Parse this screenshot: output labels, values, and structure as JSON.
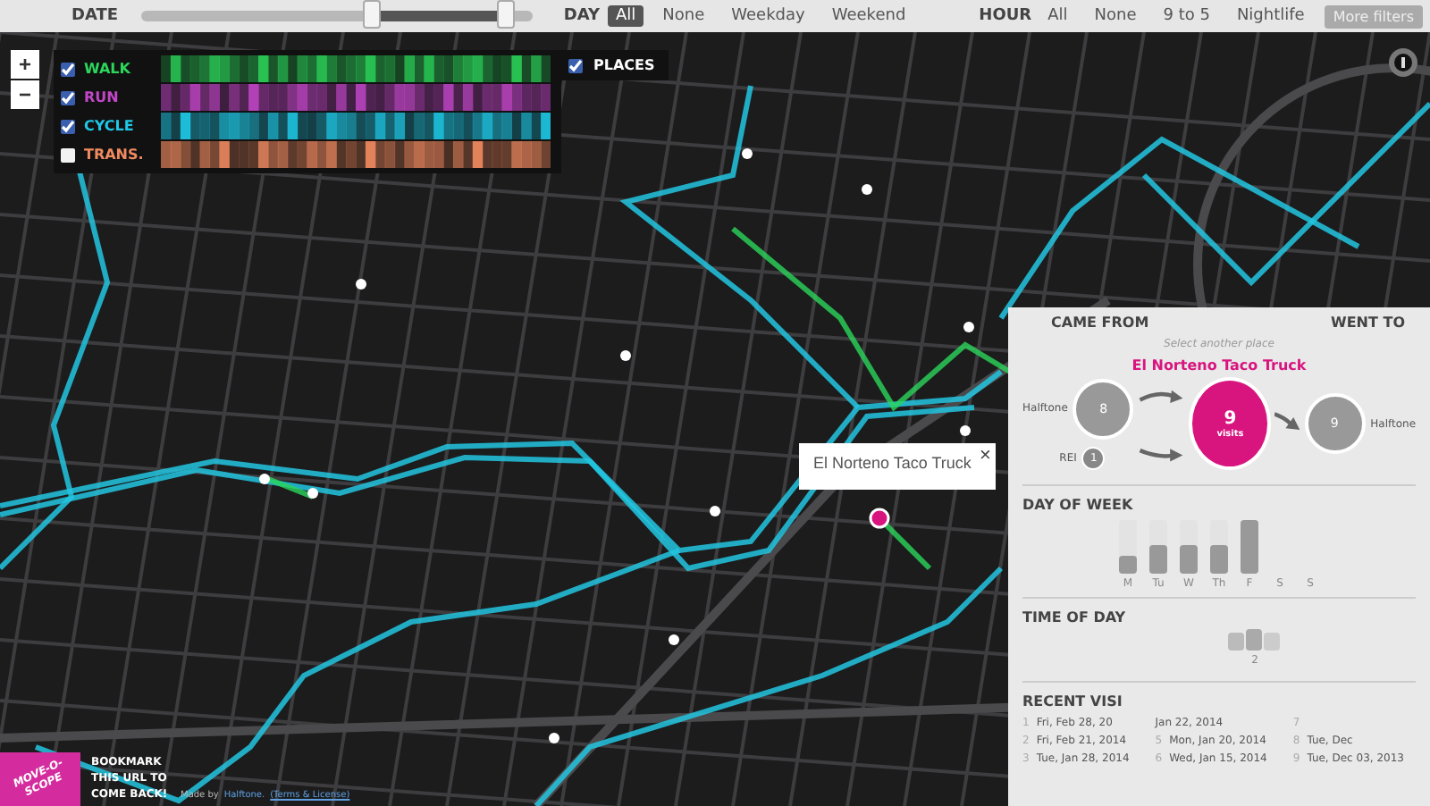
{
  "top_bar": {
    "date_label": "DATE",
    "date_handles": [
      {
        "level": 0.59
      },
      {
        "level": 0.93
      }
    ],
    "day_label": "DAY",
    "day_options": [
      {
        "label": "All",
        "selected": true
      },
      {
        "label": "None",
        "selected": false
      },
      {
        "label": "Weekday",
        "selected": false
      },
      {
        "label": "Weekend",
        "selected": false
      }
    ],
    "hour_label": "HOUR",
    "hour_options": [
      {
        "label": "All",
        "selected": false
      },
      {
        "label": "None",
        "selected": false
      },
      {
        "label": "9 to 5",
        "selected": false
      },
      {
        "label": "Nightlife",
        "selected": false
      }
    ],
    "more_button": "More filters"
  },
  "zoom": {
    "plus": "+",
    "minus": "−"
  },
  "layers": [
    {
      "label": "WALK",
      "checked": true,
      "color": "#2bd65a"
    },
    {
      "label": "RUN",
      "checked": true,
      "color": "#c246c8"
    },
    {
      "label": "CYCLE",
      "checked": true,
      "color": "#1ec8e6"
    },
    {
      "label": "TRANS.",
      "checked": false,
      "color": "#f08a60"
    }
  ],
  "places": {
    "label": "PLACES",
    "checked": true
  },
  "popup": {
    "title": "El Norteno Taco Truck",
    "close": "×"
  },
  "panel": {
    "came_from": "CAME FROM",
    "went_to": "WENT TO",
    "hint": "Select another place",
    "place": "El Norteno Taco Truck",
    "center": {
      "count": "9",
      "unit": "visits"
    },
    "sources": [
      {
        "name": "Halftone",
        "count": "8"
      },
      {
        "name": "REI",
        "count": "1"
      }
    ],
    "targets": [
      {
        "name": "Halftone",
        "count": "9"
      }
    ],
    "day_title": "DAY OF WEEK",
    "days": [
      {
        "label": "M",
        "level": 0.35
      },
      {
        "label": "Tu",
        "level": 0.55
      },
      {
        "label": "W",
        "level": 0.55
      },
      {
        "label": "Th",
        "level": 0.55
      },
      {
        "label": "F",
        "level": 1
      },
      {
        "label": "S"
      },
      {
        "label": "S"
      }
    ],
    "time_title": "TIME OF DAY",
    "time_tick": "2",
    "recent_title": "RECENT VISI",
    "visits": [
      {
        "num": "1",
        "date": "Fri, Feb 28, 20"
      },
      {
        "num": "2",
        "date": "Fri, Feb 21, 2014"
      },
      {
        "num": "3",
        "date": "Tue, Jan 28, 2014"
      },
      {
        "date": "Jan 22, 2014"
      },
      {
        "num": "5",
        "date": "Mon, Jan 20, 2014"
      },
      {
        "num": "6",
        "date": "Wed, Jan 15, 2014"
      },
      {
        "num": "7"
      },
      {
        "num": "8",
        "date": "Tue, Dec"
      },
      {
        "num": "9",
        "date": "Tue, Dec 03, 2013"
      }
    ]
  },
  "footer": {
    "logo": "MOVE-O-SCOPE",
    "bookmark": "BOOKMARK THIS URL TO COME BACK!",
    "made_by": "Made by",
    "maker_link": "Halftone.",
    "terms_link": "(Terms & License)"
  }
}
